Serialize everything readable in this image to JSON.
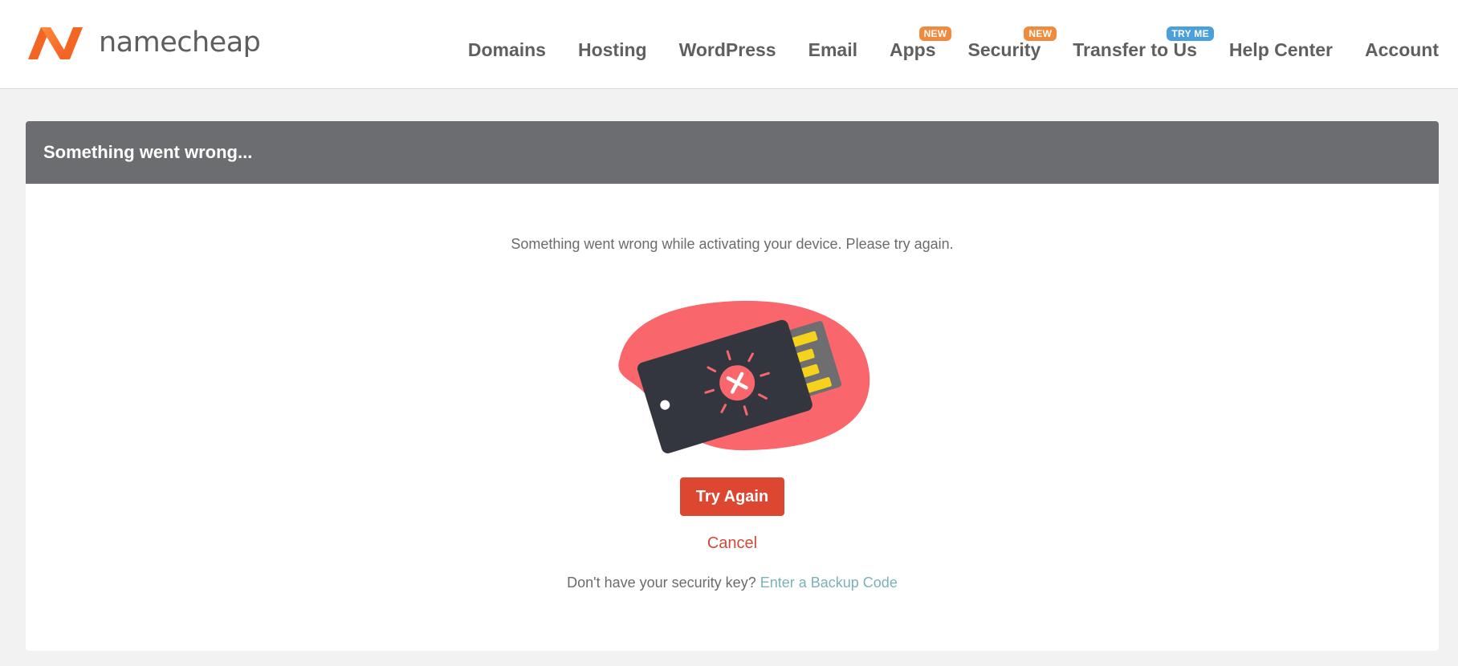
{
  "header": {
    "logo_text": "namecheap",
    "nav": [
      {
        "label": "Domains",
        "badge": ""
      },
      {
        "label": "Hosting",
        "badge": ""
      },
      {
        "label": "WordPress",
        "badge": ""
      },
      {
        "label": "Email",
        "badge": ""
      },
      {
        "label": "Apps",
        "badge": "NEW"
      },
      {
        "label": "Security",
        "badge": "NEW"
      },
      {
        "label": "Transfer to Us",
        "badge": "TRY ME"
      },
      {
        "label": "Help Center",
        "badge": ""
      },
      {
        "label": "Account",
        "badge": ""
      }
    ]
  },
  "panel": {
    "title": "Something went wrong...",
    "message": "Something went wrong while activating your device. Please try again.",
    "try_again_label": "Try Again",
    "cancel_label": "Cancel",
    "backup_prompt": "Don't have your security key?",
    "backup_link": "Enter a Backup Code"
  },
  "colors": {
    "brand_orange": "#f26522",
    "button_red": "#dd4731",
    "header_gray": "#6c6d70",
    "blob_coral": "#f9666c",
    "key_dark": "#33363f",
    "contact_yellow": "#f5d21b",
    "link_teal": "#7bb2b8",
    "badge_new": "#f08a3c",
    "badge_tryme": "#4aa0da"
  },
  "icons": {
    "logo": "namecheap-logo-icon",
    "illustration": "security-key-error-icon"
  }
}
